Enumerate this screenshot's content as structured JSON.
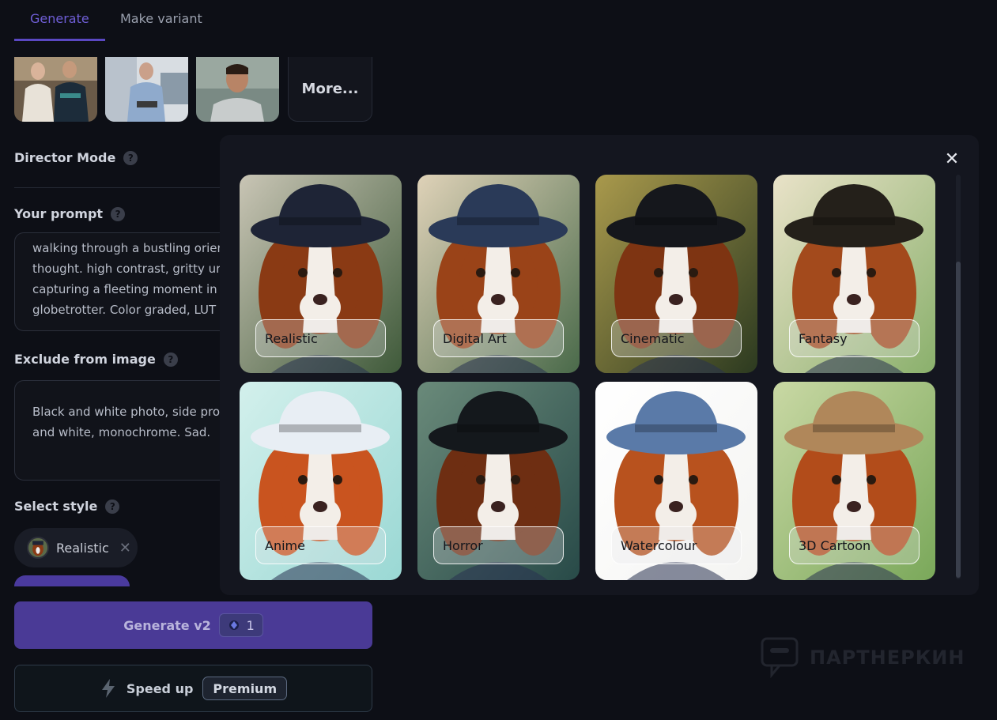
{
  "tabs": [
    {
      "label": "Generate",
      "active": true
    },
    {
      "label": "Make variant",
      "active": false
    }
  ],
  "thumbnails": {
    "more_label": "More..."
  },
  "director_mode": {
    "label": "Director Mode",
    "help": "?"
  },
  "prompt": {
    "label": "Your prompt",
    "help": "?",
    "lines": [
      "walking through a bustling orien",
      "thought. high contrast, gritty ur",
      "capturing a fleeting moment in",
      "globetrotter. Color graded, LUT"
    ]
  },
  "exclude": {
    "label": "Exclude from image",
    "help": "?",
    "lines": [
      "Black and white photo, side pro",
      "and white, monochrome. Sad."
    ]
  },
  "select_style": {
    "label": "Select style",
    "help": "?",
    "selected": "Realistic"
  },
  "generate_button": {
    "label": "Generate v2",
    "credits": "1"
  },
  "speed_up_button": {
    "label": "Speed up",
    "badge": "Premium"
  },
  "watermark": "ПАРТНЕРКИН",
  "style_modal": {
    "close": "✕",
    "styles": [
      {
        "label": "Realistic",
        "bg1": "#3f5a3a",
        "bg2": "#c9c5b5",
        "hat": "#1e2436",
        "fur": "#8a3a14"
      },
      {
        "label": "Digital Art",
        "bg1": "#4a6a4a",
        "bg2": "#dfd2b8",
        "hat": "#2a3a58",
        "fur": "#9a4318"
      },
      {
        "label": "Cinematic",
        "bg1": "#2c3a20",
        "bg2": "#a9994c",
        "hat": "#15171c",
        "fur": "#7e3412"
      },
      {
        "label": "Fantasy",
        "bg1": "#8ab06c",
        "bg2": "#e9e2c8",
        "hat": "#24201a",
        "fur": "#a34a1c"
      },
      {
        "label": "Anime",
        "bg1": "#9ad8d4",
        "bg2": "#d3f0ec",
        "hat": "#e8eef4",
        "fur": "#c9541f"
      },
      {
        "label": "Horror",
        "bg1": "#284a48",
        "bg2": "#6a8a7a",
        "hat": "#14181c",
        "fur": "#6e2e12"
      },
      {
        "label": "Watercolour",
        "bg1": "#f4f4f2",
        "bg2": "#ffffff",
        "hat": "#5a7aa8",
        "fur": "#b8521e"
      },
      {
        "label": "3D Cartoon",
        "bg1": "#7aa85a",
        "bg2": "#c9d8a4",
        "hat": "#b0875a",
        "fur": "#b24c1a"
      }
    ]
  }
}
